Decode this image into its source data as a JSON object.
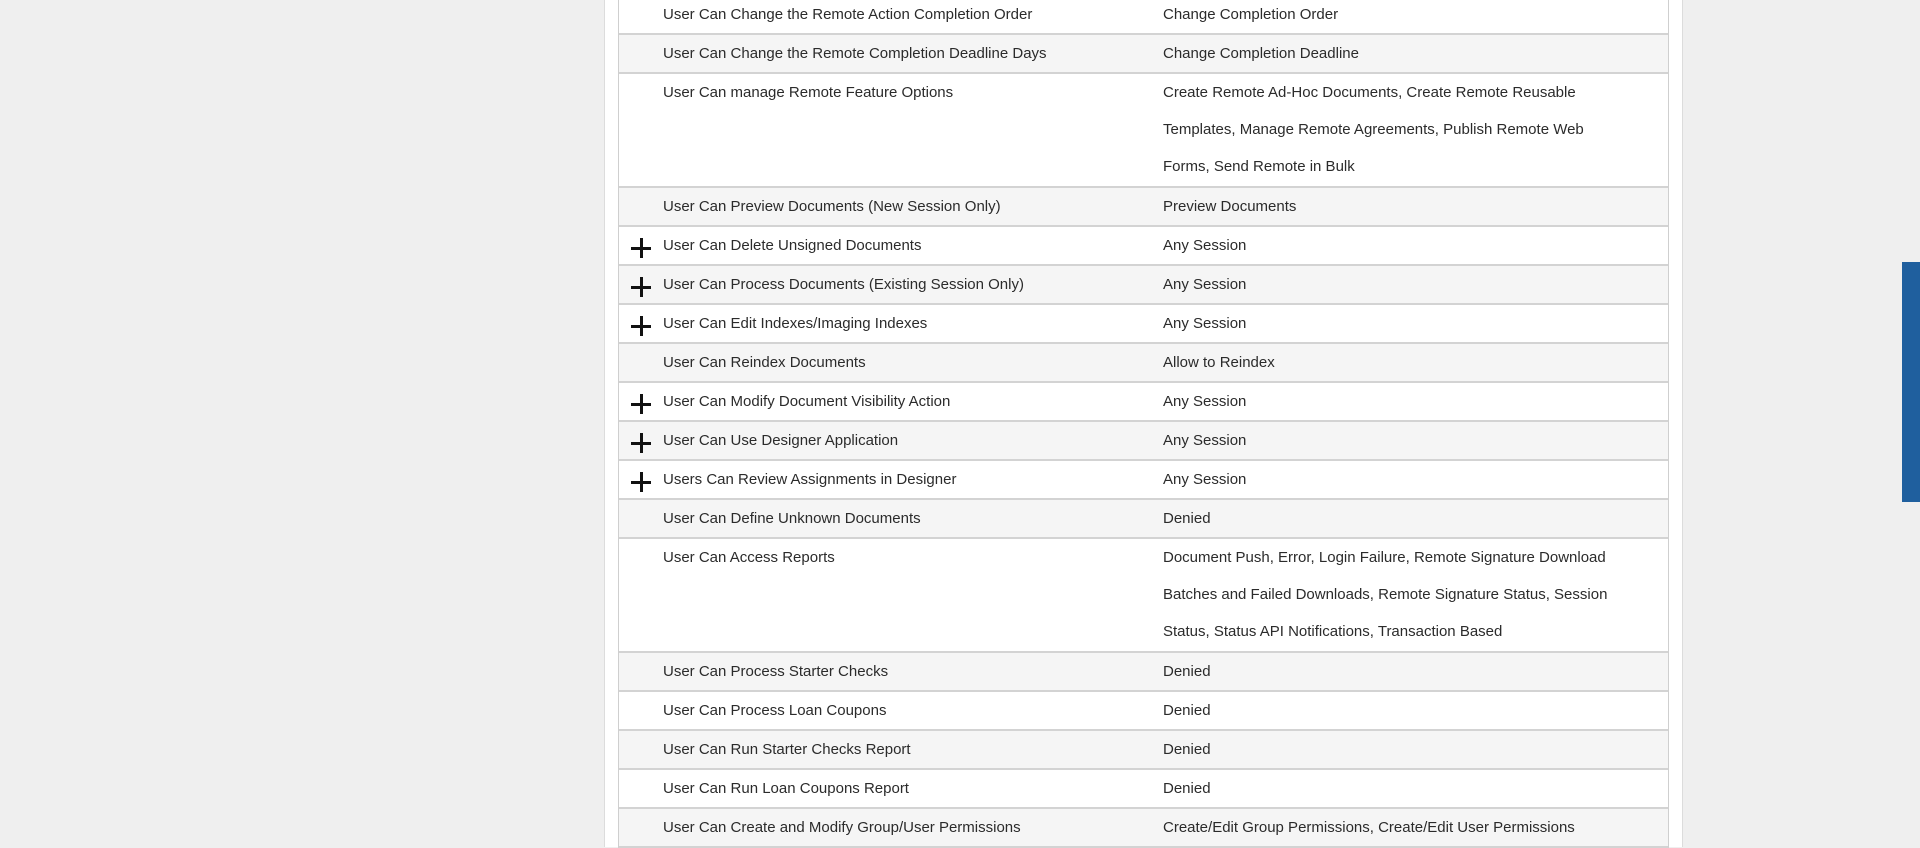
{
  "permissions": [
    {
      "name": "User Can Change the Remote Action Completion Order",
      "value": "Change Completion Order",
      "expandable": false
    },
    {
      "name": "User Can Change the Remote Completion Deadline Days",
      "value": "Change Completion Deadline",
      "expandable": false
    },
    {
      "name": "User Can manage Remote Feature Options",
      "value": "Create Remote Ad-Hoc Documents, Create Remote Reusable Templates, Manage Remote Agreements, Publish Remote Web Forms, Send Remote in Bulk",
      "expandable": false
    },
    {
      "name": "User Can Preview Documents (New Session Only)",
      "value": "Preview Documents",
      "expandable": false
    },
    {
      "name": "User Can Delete Unsigned Documents",
      "value": "Any Session",
      "expandable": true
    },
    {
      "name": "User Can Process Documents (Existing Session Only)",
      "value": "Any Session",
      "expandable": true
    },
    {
      "name": "User Can Edit Indexes/Imaging Indexes",
      "value": "Any Session",
      "expandable": true
    },
    {
      "name": "User Can Reindex Documents",
      "value": "Allow to Reindex",
      "expandable": false
    },
    {
      "name": "User Can Modify Document Visibility Action",
      "value": "Any Session",
      "expandable": true
    },
    {
      "name": "User Can Use Designer Application",
      "value": "Any Session",
      "expandable": true
    },
    {
      "name": "Users Can Review Assignments in Designer",
      "value": "Any Session",
      "expandable": true
    },
    {
      "name": "User Can Define Unknown Documents",
      "value": "Denied",
      "expandable": false
    },
    {
      "name": "User Can Access Reports",
      "value": "Document Push, Error, Login Failure, Remote Signature Download Batches and Failed Downloads, Remote Signature Status, Session Status, Status API Notifications, Transaction Based",
      "expandable": false
    },
    {
      "name": "User Can Process Starter Checks",
      "value": "Denied",
      "expandable": false
    },
    {
      "name": "User Can Process Loan Coupons",
      "value": "Denied",
      "expandable": false
    },
    {
      "name": "User Can Run Starter Checks Report",
      "value": "Denied",
      "expandable": false
    },
    {
      "name": "User Can Run Loan Coupons Report",
      "value": "Denied",
      "expandable": false
    },
    {
      "name": "User Can Create and Modify Group/User Permissions",
      "value": "Create/Edit Group Permissions, Create/Edit User Permissions",
      "expandable": false
    }
  ]
}
